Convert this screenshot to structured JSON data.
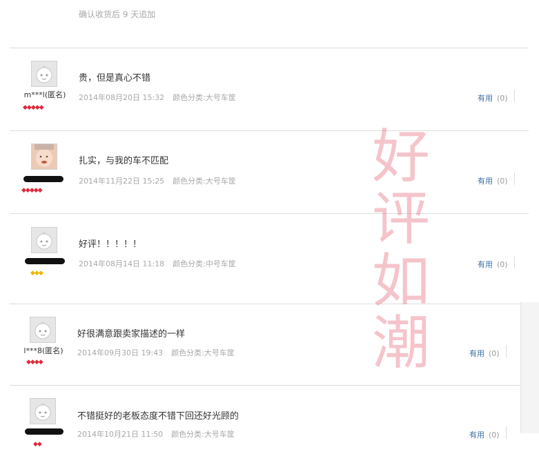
{
  "top_note": "确认收货后 9 天追加",
  "watermark": [
    "好",
    "评",
    "如",
    "潮"
  ],
  "useful_label": "有用",
  "reviews": [
    {
      "username": "m***l(匿名)",
      "content": "贵，但是真心不错",
      "date": "2014年08月20日 15:32",
      "variant": "颜色分类:大号车筐",
      "useful_count": "(0)"
    },
    {
      "username": "",
      "content": "扎实，与我的车不匹配",
      "date": "2014年11月22日 15:25",
      "variant": "颜色分类:大号车筐",
      "useful_count": "(0)"
    },
    {
      "username": "",
      "content": "好评！！！！！",
      "date": "2014年08月14日 11:18",
      "variant": "颜色分类:中号车筐",
      "useful_count": "(0)"
    },
    {
      "username": "l***8(匿名)",
      "content": "好很满意跟卖家描述的一样",
      "date": "2014年09月30日 19:43",
      "variant": "颜色分类:大号车筐",
      "useful_count": "(0)"
    },
    {
      "username": "",
      "content": "不错挺好的老板态度不错下回还好光顾的",
      "date": "2014年10月21日 11:50",
      "variant": "颜色分类:大号车筐",
      "useful_count": "(0)"
    }
  ],
  "colors": {
    "gem_red": "#e0283c",
    "gem_yellow": "#f2b600",
    "link": "#3a6ea5",
    "watermark": "#e46476"
  }
}
